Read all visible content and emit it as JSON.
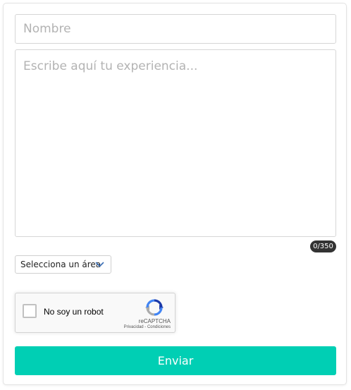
{
  "form": {
    "name_field": {
      "value": "",
      "placeholder": "Nombre"
    },
    "experience_field": {
      "value": "",
      "placeholder": "Escribe aquí tu experiencia..."
    },
    "char_counter": "0/350",
    "area_select": {
      "selected": "Selecciona un área",
      "icon": "chevron-down-icon"
    },
    "recaptcha": {
      "label": "No soy un robot",
      "brand": "reCAPTCHA",
      "privacy": "Privacidad",
      "separator": " - ",
      "terms": "Condiciones",
      "checked": false,
      "icon": "recaptcha-logo-icon"
    },
    "submit_label": "Enviar"
  },
  "colors": {
    "accent": "#00cfb4",
    "counter_bg": "#333333",
    "chevron": "#3b6fb6"
  }
}
